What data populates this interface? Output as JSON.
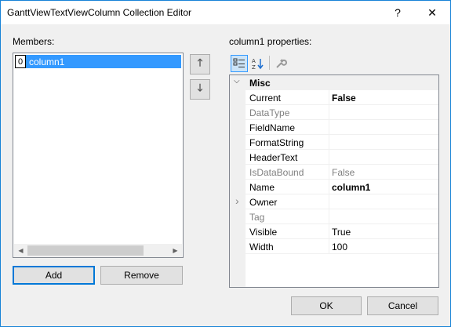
{
  "window": {
    "title": "GanttViewTextViewColumn Collection Editor",
    "help_glyph": "?",
    "close_glyph": "✕"
  },
  "members": {
    "label": "Members:",
    "items": [
      {
        "index": "0",
        "name": "column1",
        "selected": true
      }
    ],
    "scroll_left_glyph": "◀",
    "scroll_right_glyph": "▶"
  },
  "move_up_glyph": "🡑",
  "move_down_glyph": "🡓",
  "buttons": {
    "add": "Add",
    "remove": "Remove",
    "ok": "OK",
    "cancel": "Cancel"
  },
  "properties": {
    "label": "column1 properties:",
    "toolbar": {
      "categorized_icon": "categorized-icon",
      "alphabetical_icon": "alphabetical-icon",
      "property_pages_icon": "wrench-icon"
    },
    "category": "Misc",
    "rows": [
      {
        "name": "Current",
        "value": "False",
        "bold": true,
        "readonly": false,
        "expand": false
      },
      {
        "name": "DataType",
        "value": "",
        "bold": false,
        "readonly": true,
        "expand": false
      },
      {
        "name": "FieldName",
        "value": "",
        "bold": false,
        "readonly": false,
        "expand": false
      },
      {
        "name": "FormatString",
        "value": "",
        "bold": false,
        "readonly": false,
        "expand": false
      },
      {
        "name": "HeaderText",
        "value": "",
        "bold": false,
        "readonly": false,
        "expand": false
      },
      {
        "name": "IsDataBound",
        "value": "False",
        "bold": false,
        "readonly": true,
        "expand": false
      },
      {
        "name": "Name",
        "value": "column1",
        "bold": true,
        "readonly": false,
        "expand": false
      },
      {
        "name": "Owner",
        "value": "",
        "bold": false,
        "readonly": false,
        "expand": true
      },
      {
        "name": "Tag",
        "value": "",
        "bold": false,
        "readonly": true,
        "expand": false
      },
      {
        "name": "Visible",
        "value": "True",
        "bold": false,
        "readonly": false,
        "expand": false
      },
      {
        "name": "Width",
        "value": "100",
        "bold": false,
        "readonly": false,
        "expand": false
      }
    ]
  },
  "colors": {
    "selection": "#3399ff",
    "accent_border": "#0078d7",
    "window_border": "#1883d7"
  }
}
